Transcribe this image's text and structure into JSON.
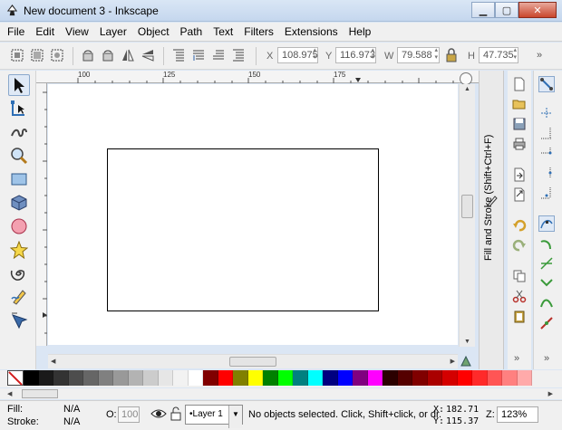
{
  "window": {
    "title": "New document 3 - Inkscape",
    "buttons": {
      "minimize": "▁",
      "maximize": "▢",
      "close": "✕"
    }
  },
  "menu": [
    "File",
    "Edit",
    "View",
    "Layer",
    "Object",
    "Path",
    "Text",
    "Filters",
    "Extensions",
    "Help"
  ],
  "controls": {
    "x_label": "X",
    "x_value": "108.975",
    "y_label": "Y",
    "y_value": "116.973",
    "w_label": "W",
    "w_value": "79.588",
    "h_label": "H",
    "h_value": "47.735",
    "more": "»"
  },
  "toolbox": [
    "selector-tool",
    "node-tool",
    "tweak-tool",
    "zoom-tool",
    "rect-tool",
    "3dbox-tool",
    "circle-tool",
    "star-tool",
    "spiral-tool",
    "pencil-tool",
    "pen-tool"
  ],
  "rulers": {
    "h_labels": [
      "100",
      "125",
      "150",
      "175"
    ]
  },
  "dock": {
    "title": "Fill and Stroke (Shift+Ctrl+F)"
  },
  "palette": {
    "colors": [
      "#000000",
      "#1a1a1a",
      "#333333",
      "#4d4d4d",
      "#666666",
      "#808080",
      "#999999",
      "#b3b3b3",
      "#cccccc",
      "#e6e6e6",
      "#f2f2f2",
      "#ffffff",
      "#800000",
      "#ff0000",
      "#808000",
      "#ffff00",
      "#008000",
      "#00ff00",
      "#008080",
      "#00ffff",
      "#000080",
      "#0000ff",
      "#800080",
      "#ff00ff",
      "#2b0000",
      "#550000",
      "#800000",
      "#aa0000",
      "#d40000",
      "#ff0000",
      "#ff2a2a",
      "#ff5555",
      "#ff8080",
      "#ffaaaa"
    ]
  },
  "status": {
    "fill_label": "Fill:",
    "fill_value": "N/A",
    "stroke_label": "Stroke:",
    "stroke_value": "N/A",
    "opacity_label": "O:",
    "opacity_value": "100",
    "layer": "•Layer 1",
    "message": "No objects selected. Click, Shift+click, or dr.",
    "x_label": "X:",
    "x_value": "182.71",
    "y_label": "Y:",
    "y_value": "115.37",
    "zoom_label": "Z:",
    "zoom_value": "123%"
  }
}
